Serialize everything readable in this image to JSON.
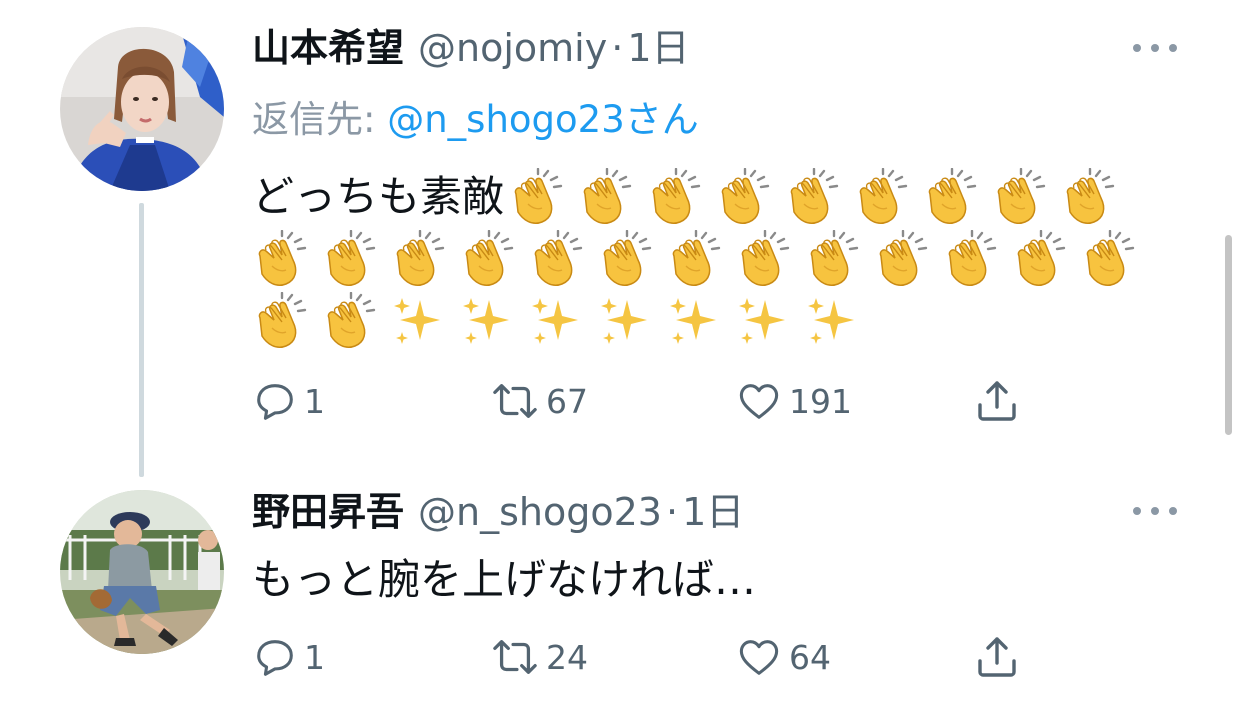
{
  "tweets": [
    {
      "author_name": "山本希望",
      "handle": "@nojomiy",
      "separator": "·",
      "time": "1日",
      "reply_label": "返信先:",
      "reply_target": "@n_shogo23さん",
      "text": "どっちも素敵",
      "clap_count_line1": 9,
      "clap_count_line2": 13,
      "clap_count_line3": 2,
      "sparkle_count": 7,
      "replies": "1",
      "retweets": "67",
      "likes": "191"
    },
    {
      "author_name": "野田昇吾",
      "handle": "@n_shogo23",
      "separator": "·",
      "time": "1日",
      "text": "もっと腕を上げなければ…",
      "replies": "1",
      "retweets": "24",
      "likes": "64"
    }
  ],
  "icons": {
    "reply": "reply-icon",
    "retweet": "retweet-icon",
    "like": "heart-icon",
    "share": "share-icon",
    "more": "more-options-icon",
    "clap": "clapping-hands-emoji",
    "sparkles": "sparkles-emoji"
  },
  "colors": {
    "name": "#0f1419",
    "secondary": "#536471",
    "link": "#1d9bf0",
    "thread_line": "#cfd9de"
  }
}
